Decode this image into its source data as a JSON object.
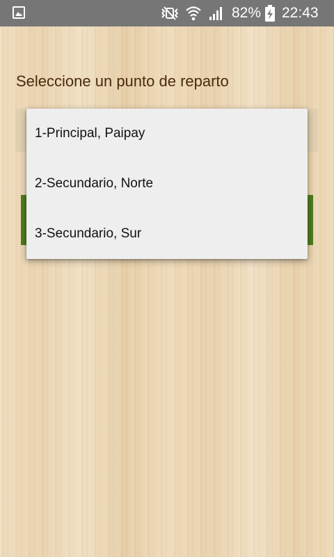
{
  "status_bar": {
    "battery_percent": "82%",
    "time": "22:43",
    "icons": [
      "gallery-icon",
      "mute-icon",
      "wifi-icon",
      "signal-icon",
      "battery-charging-icon"
    ]
  },
  "prompt": {
    "label": "Seleccione un punto de reparto"
  },
  "dropdown": {
    "options": [
      {
        "label": "1-Principal, Paipay"
      },
      {
        "label": "2-Secundario, Norte"
      },
      {
        "label": "3-Secundario, Sur"
      }
    ]
  },
  "colors": {
    "status_bar": "#767676",
    "label_text": "#4a2a10",
    "button_green": "#4e7d1e",
    "dropdown_bg": "#eeeeee"
  }
}
